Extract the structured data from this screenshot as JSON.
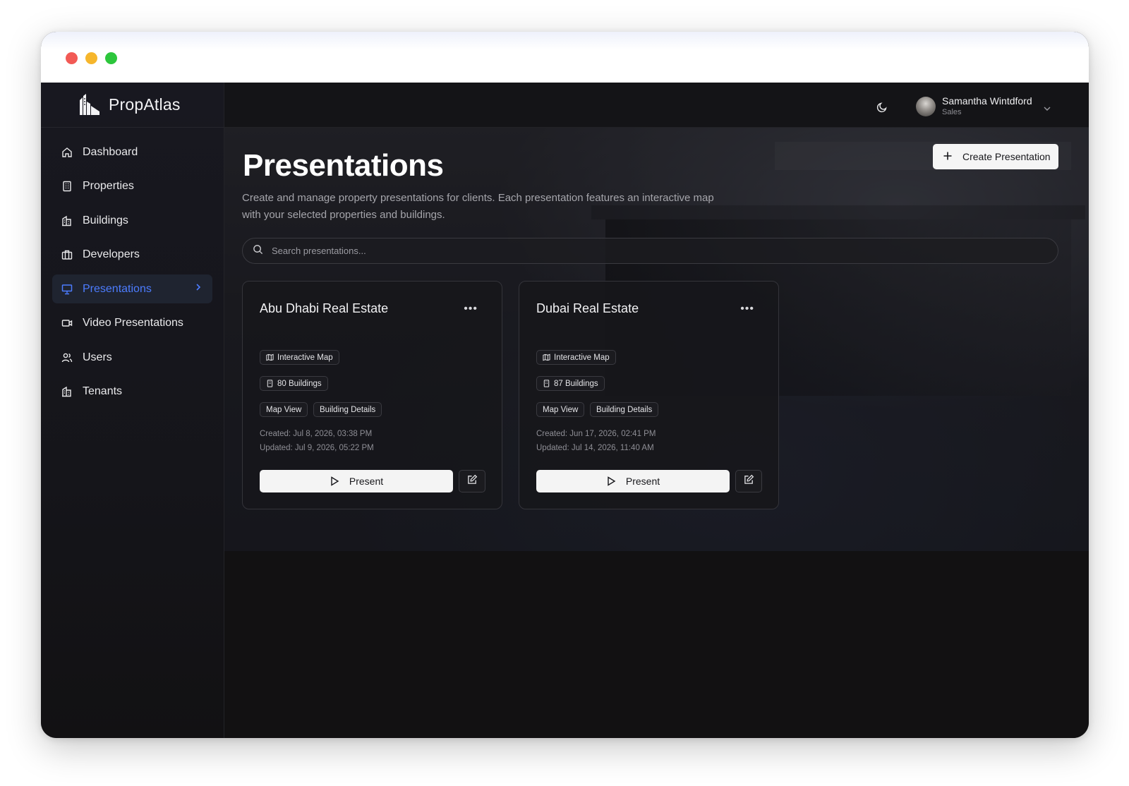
{
  "window": {
    "controls": [
      "close",
      "minimize",
      "maximize"
    ]
  },
  "brand": {
    "name": "PropAtlas",
    "logo_icon": "buildings-logo-icon"
  },
  "sidebar": {
    "items": [
      {
        "label": "Dashboard",
        "icon": "home-icon",
        "active": false
      },
      {
        "label": "Properties",
        "icon": "building-icon",
        "active": false
      },
      {
        "label": "Buildings",
        "icon": "buildings-icon",
        "active": false
      },
      {
        "label": "Developers",
        "icon": "briefcase-icon",
        "active": false
      },
      {
        "label": "Presentations",
        "icon": "presentation-icon",
        "active": true
      },
      {
        "label": "Video Presentations",
        "icon": "video-icon",
        "active": false
      },
      {
        "label": "Users",
        "icon": "users-icon",
        "active": false
      },
      {
        "label": "Tenants",
        "icon": "tenants-icon",
        "active": false
      }
    ],
    "active_color": "#4c7cff"
  },
  "topbar": {
    "theme_icon": "moon-icon",
    "user": {
      "name": "Samantha Wintdford",
      "role": "Sales"
    }
  },
  "page": {
    "title": "Presentations",
    "description": "Create and manage property presentations for clients. Each presentation features an interactive map with your selected properties and buildings.",
    "create_label": "Create Presentation",
    "search_placeholder": "Search presentations..."
  },
  "cards": [
    {
      "title": "Abu Dhabi Real Estate",
      "badges": {
        "map": "Interactive Map",
        "buildings": "80 Buildings",
        "tag1": "Map View",
        "tag2": "Building Details"
      },
      "created": "Created: Jul 8, 2026, 03:38 PM",
      "updated": "Updated: Jul 9, 2026, 05:22 PM",
      "present_label": "Present"
    },
    {
      "title": "Dubai Real Estate",
      "badges": {
        "map": "Interactive Map",
        "buildings": "87 Buildings",
        "tag1": "Map View",
        "tag2": "Building Details"
      },
      "created": "Created: Jun 17, 2026, 02:41 PM",
      "updated": "Updated: Jul 14, 2026, 11:40 AM",
      "present_label": "Present"
    }
  ]
}
